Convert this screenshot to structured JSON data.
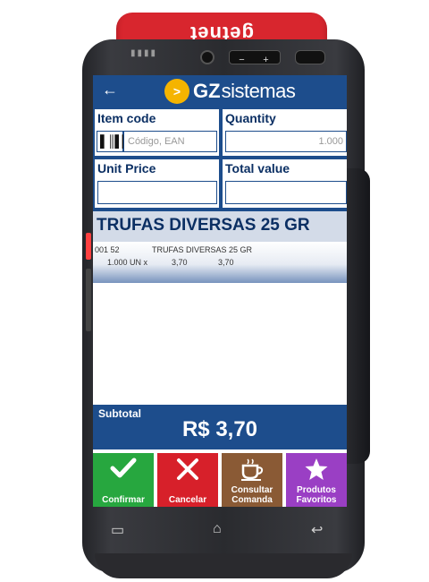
{
  "device": {
    "brand": "getnet",
    "volume_minus": "−",
    "volume_plus": "+"
  },
  "header": {
    "back_icon": "←",
    "logo_mark": ">",
    "logo_gz": "GZ",
    "logo_sis": "sistemas"
  },
  "form": {
    "item_code_label": "Item code",
    "item_code_placeholder": "Código, EAN",
    "quantity_label": "Quantity",
    "quantity_value": "1.000",
    "unit_price_label": "Unit Price",
    "unit_price_value": "",
    "total_value_label": "Total value",
    "total_value_value": ""
  },
  "product_banner": "TRUFAS DIVERSAS 25 GR",
  "items": [
    {
      "code": "001 52",
      "name": "TRUFAS DIVERSAS 25 GR",
      "qty": "1.000 UN x",
      "unit_price": "3,70",
      "total": "3,70"
    }
  ],
  "subtotal": {
    "label": "Subtotal",
    "value": "R$ 3,70"
  },
  "buttons": {
    "confirm": "Confirmar",
    "cancel": "Cancelar",
    "consult": "Consultar Comanda",
    "favorites": "Produtos Favoritos"
  },
  "colors": {
    "primary": "#1d4d8c",
    "confirm": "#27a73f",
    "cancel": "#d7202a",
    "consult": "#8a5a35",
    "favorites": "#9a3fc4",
    "printer": "#d8262e"
  }
}
